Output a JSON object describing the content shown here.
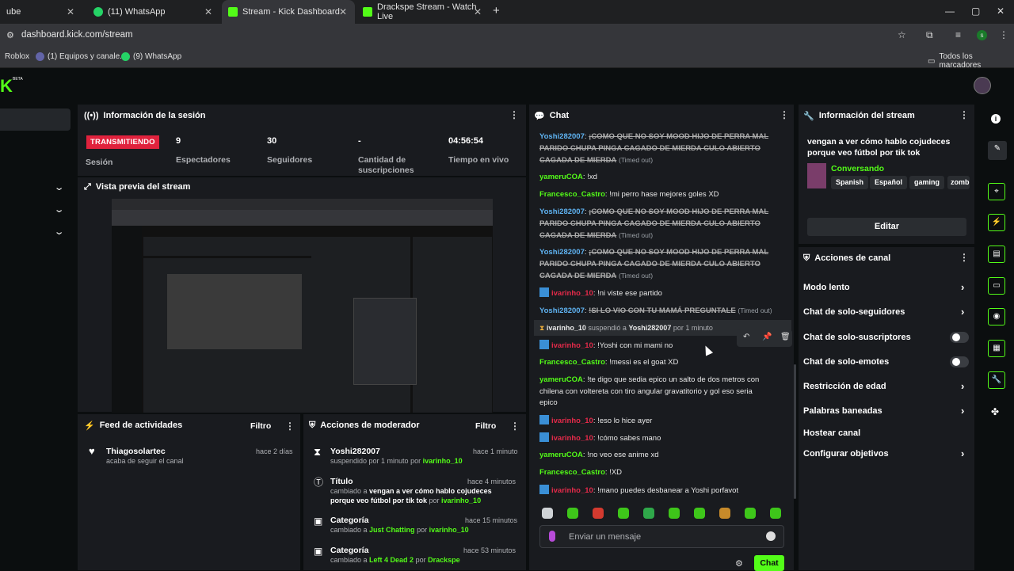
{
  "browser": {
    "tabs": [
      {
        "title": "ube"
      },
      {
        "title": "(11) WhatsApp"
      },
      {
        "title": "Stream - Kick Dashboard"
      },
      {
        "title": "Drackspe Stream - Watch Live"
      }
    ],
    "url": "dashboard.kick.com/stream",
    "bookmarks": [
      "Roblox",
      "(1) Equipos y canale...",
      "(9) WhatsApp"
    ],
    "all_bookmarks": "Todos los marcadores",
    "profile_initial": "s"
  },
  "app": {
    "logo": "K",
    "beta": "BETA"
  },
  "session": {
    "title": "Información de la sesión",
    "status": "TRANSMITIENDO",
    "status_label": "Sesión",
    "stats": [
      {
        "value": "9",
        "label": "Espectadores"
      },
      {
        "value": "30",
        "label": "Seguidores"
      },
      {
        "value": "-",
        "label": "Cantidad de suscripciones"
      },
      {
        "value": "04:56:54",
        "label": "Tiempo en vivo"
      }
    ]
  },
  "preview": {
    "title": "Vista previa del stream"
  },
  "feed": {
    "title": "Feed de actividades",
    "filter": "Filtro",
    "items": [
      {
        "user": "Thiagosolartec",
        "action": "acaba de seguir el canal",
        "time": "hace 2 días"
      }
    ]
  },
  "modactions": {
    "title": "Acciones de moderador",
    "filter": "Filtro",
    "items": [
      {
        "title": "Yoshi282007",
        "line1": "suspendido por 1 minuto por",
        "user": "ivarinho_10",
        "time": "hace 1 minuto"
      },
      {
        "title": "Título",
        "line1": "cambiado a",
        "value": "vengan a ver cómo hablo cojudeces porque veo fútbol por tik tok",
        "by": "por",
        "user": "ivarinho_10",
        "time": "hace 4 minutos"
      },
      {
        "title": "Categoría",
        "line1": "cambiado a",
        "value": "Just Chatting",
        "by": "por",
        "user": "ivarinho_10",
        "time": "hace 15 minutos"
      },
      {
        "title": "Categoría",
        "line1": "cambiado a",
        "value": "Left 4 Dead 2",
        "by": "por",
        "user": "Drackspe",
        "time": "hace 53 minutos"
      }
    ]
  },
  "chat": {
    "title": "Chat",
    "messages": [
      {
        "user": "Yoshi282007",
        "text": "¡COMO QUE NO SOY MOOD HIJO DE PERRA MAL PARIDO CHUPA PINGA CAGADO DE MIERDA CULO ABIERTO CAGADA DE MIERDA",
        "note": "(Timed out)"
      },
      {
        "user": "yameruCOA",
        "text": "!xd"
      },
      {
        "user": "Francesco_Castro",
        "text": "!mi perro hase mejores goles XD"
      },
      {
        "user": "Yoshi282007",
        "text": "¡COMO QUE NO SOY MOOD HIJO DE PERRA MAL PARIDO CHUPA PINGA CAGADO DE MIERDA CULO ABIERTO CAGADA DE MIERDA",
        "note": "(Timed out)"
      },
      {
        "user": "Yoshi282007",
        "text": "¡COMO QUE NO SOY MOOD HIJO DE PERRA MAL PARIDO CHUPA PINGA CAGADO DE MIERDA CULO ABIERTO CAGADA DE MIERDA",
        "note": "(Timed out)"
      },
      {
        "user": "ivarinho_10",
        "text": "!ni viste ese partido"
      },
      {
        "user": "Yoshi282007",
        "text": "!SI LO VIO CON TU MAMÁ PREGUNTALE",
        "note": "(Timed out)"
      },
      {
        "user": "ivarinho_10",
        "text": "suspendió a",
        "target": "Yoshi282007",
        "extra": "por 1 minuto"
      },
      {
        "user": "ivarinho_10",
        "text": "!Yoshi con mi mami no"
      },
      {
        "user": "Francesco_Castro",
        "text": "!messi es el goat XD"
      },
      {
        "user": "yameruCOA",
        "text": "!te digo que sedia epico un salto de dos metros con chilena con voltereta con tiro angular gravatitorio y gol eso seria epico"
      },
      {
        "user": "ivarinho_10",
        "text": "!eso lo hice ayer"
      },
      {
        "user": "ivarinho_10",
        "text": "!cómo sabes mano"
      },
      {
        "user": "yameruCOA",
        "text": "!no veo ese anime xd"
      },
      {
        "user": "Francesco_Castro",
        "text": "!XD"
      },
      {
        "user": "ivarinho_10",
        "text": "!mano puedes desbanear a Yoshi porfavot"
      }
    ],
    "placeholder": "Enviar un mensaje",
    "send": "Chat"
  },
  "streaminfo": {
    "title": "Información del stream",
    "stream_title": "vengan a ver cómo hablo cojudeces porque veo fútbol por tik tok",
    "category": "Conversando",
    "tags": [
      "Spanish",
      "Español",
      "gaming",
      "zomb"
    ],
    "edit": "Editar"
  },
  "channel": {
    "title": "Acciones de canal",
    "items": [
      {
        "label": "Modo lento",
        "type": "arrow"
      },
      {
        "label": "Chat de solo-seguidores",
        "type": "arrow"
      },
      {
        "label": "Chat de solo-suscriptores",
        "type": "toggle",
        "on": false
      },
      {
        "label": "Chat de solo-emotes",
        "type": "toggle",
        "on": false
      },
      {
        "label": "Restricción de edad",
        "type": "arrow"
      },
      {
        "label": "Palabras baneadas",
        "type": "arrow"
      },
      {
        "label": "Hostear canal",
        "type": "none"
      },
      {
        "label": "Configurar objetivos",
        "type": "arrow"
      }
    ]
  },
  "colors": {
    "accent": "#53fc18",
    "live": "#e0223d",
    "panel": "#191b1f"
  }
}
